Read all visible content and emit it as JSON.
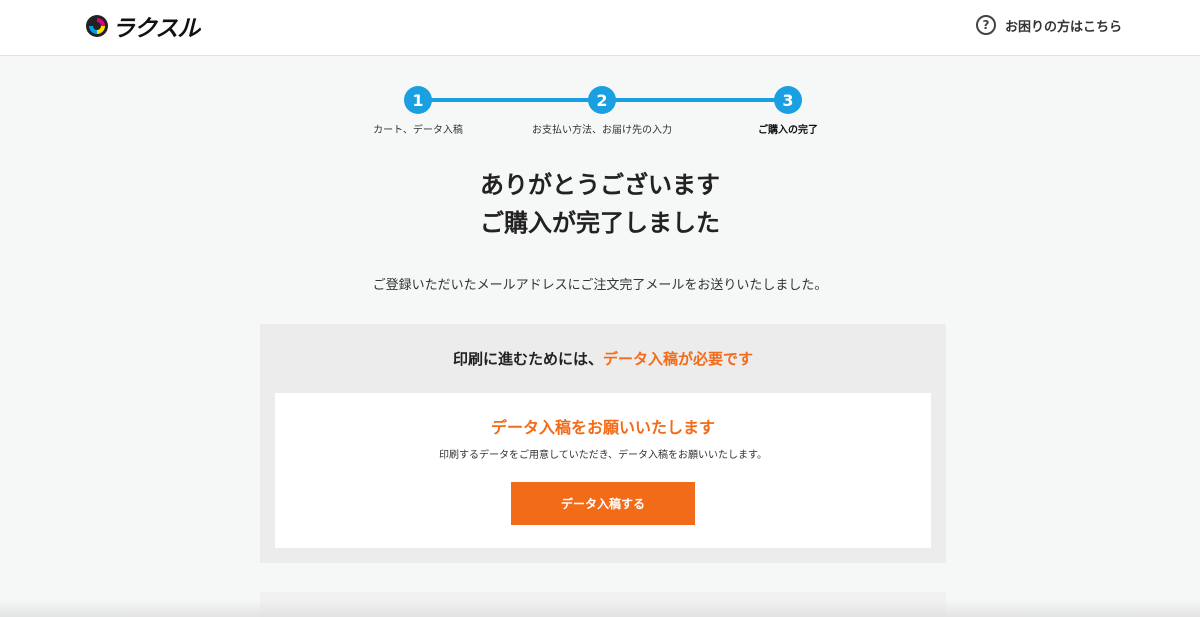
{
  "header": {
    "logo_text": "ラクスル",
    "help_icon": "question-circle-icon",
    "help_icon_glyph": "?",
    "help_label": "お困りの方はこちら"
  },
  "steps": [
    {
      "number": "1",
      "label": "カート、データ入稿"
    },
    {
      "number": "2",
      "label": "お支払い方法、お届け先の入力"
    },
    {
      "number": "3",
      "label": "ご購入の完了"
    }
  ],
  "main": {
    "title_line1": "ありがとうございます",
    "title_line2": "ご購入が完了しました",
    "subtitle": "ご登録いただいたメールアドレスにご注文完了メールをお送りいたしました。"
  },
  "panel": {
    "heading_prefix": "印刷に進むためには、",
    "heading_highlight": "データ入稿が必要です",
    "card_title": "データ入稿をお願いいたします",
    "card_desc": "印刷するデータをご用意していただき、データ入稿をお願いいたします。",
    "button_label": "データ入稿する"
  },
  "colors": {
    "accent_blue": "#1aa0e0",
    "accent_orange": "#f26b18"
  }
}
